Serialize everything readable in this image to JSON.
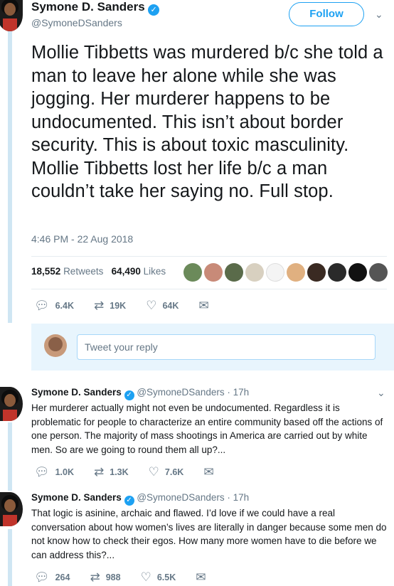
{
  "author": {
    "name": "Symone D. Sanders",
    "handle": "@SymoneDSanders"
  },
  "follow_label": "Follow",
  "tweet": {
    "text": "Mollie Tibbetts was murdered b/c she told a man to leave her alone while she was jogging. Her murderer happens to be undocumented. This isn’t about border security. This is about toxic masculinity. Mollie Tibbetts lost her life b/c a man couldn’t take her saying no. Full stop.",
    "timestamp": "4:46 PM - 22 Aug 2018",
    "retweets_count": "18,552",
    "retweets_label": "Retweets",
    "likes_count": "64,490",
    "likes_label": "Likes",
    "actions": {
      "replies": "6.4K",
      "retweets": "19K",
      "likes": "64K"
    }
  },
  "reply_placeholder": "Tweet your reply",
  "replies": [
    {
      "name": "Symone D. Sanders",
      "handle": "@SymoneDSanders · 17h",
      "text": "Her murderer actually might not even be undocumented. Regardless it is problematic for people to characterize an entire community based off the actions of one person. The majority of mass shootings in America are carried out by white men. So are we going to round them all up?...",
      "replies": "1.0K",
      "retweets": "1.3K",
      "likes": "7.6K"
    },
    {
      "name": "Symone D. Sanders",
      "handle": "@SymoneDSanders · 17h",
      "text": "That logic is asinine, archaic and flawed. I’d love if we could have a real conversation about how women’s lives are literally in danger because some men do not know how to check their egos. How many more women have to die before we can address this?...",
      "replies": "264",
      "retweets": "988",
      "likes": "6.5K"
    }
  ],
  "icons": [
    "verified-icon",
    "chevron-down-icon",
    "reply-icon",
    "retweet-icon",
    "like-icon",
    "message-icon"
  ],
  "colors": {
    "accent": "#1da1f2",
    "thread_line": "#cfe6f3",
    "muted_text": "#657786"
  }
}
